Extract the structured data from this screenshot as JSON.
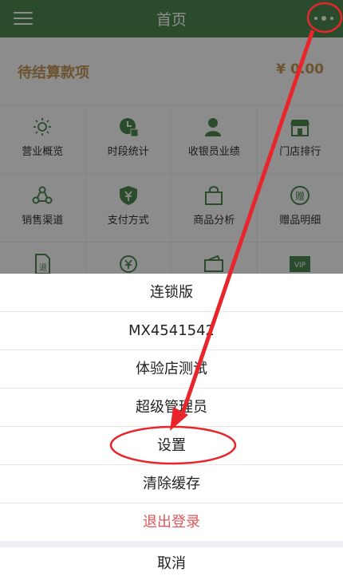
{
  "header": {
    "title": "首页",
    "color": "#4e8a52"
  },
  "pending": {
    "label": "待结算款项",
    "amount": "¥ 0.00",
    "color": "#c79a5a"
  },
  "grid": {
    "row1": [
      {
        "label": "营业概览",
        "icon": "sun-icon"
      },
      {
        "label": "时段统计",
        "icon": "clock-icon"
      },
      {
        "label": "收银员业绩",
        "icon": "cashier-icon"
      },
      {
        "label": "门店排行",
        "icon": "store-icon"
      }
    ],
    "row2": [
      {
        "label": "销售渠道",
        "icon": "channel-icon"
      },
      {
        "label": "支付方式",
        "icon": "payment-shield-icon"
      },
      {
        "label": "商品分析",
        "icon": "shopping-bag-icon"
      },
      {
        "label": "赠品明细",
        "icon": "gift-icon"
      }
    ],
    "row3": [
      {
        "label": "",
        "icon": "refund-doc-icon"
      },
      {
        "label": "",
        "icon": "yuan-coin-icon"
      },
      {
        "label": "",
        "icon": "coupon-icon"
      },
      {
        "label": "",
        "icon": "vip-icon"
      }
    ]
  },
  "sheet": {
    "items": [
      {
        "label": "连锁版"
      },
      {
        "label": "MX4541542"
      },
      {
        "label": "体验店测试"
      },
      {
        "label": "超级管理员"
      },
      {
        "label": "设置"
      },
      {
        "label": "清除缓存"
      },
      {
        "label": "退出登录"
      }
    ],
    "cancel": "取消",
    "logout_color": "#e0565b"
  },
  "annotation_color": "#e8252a"
}
